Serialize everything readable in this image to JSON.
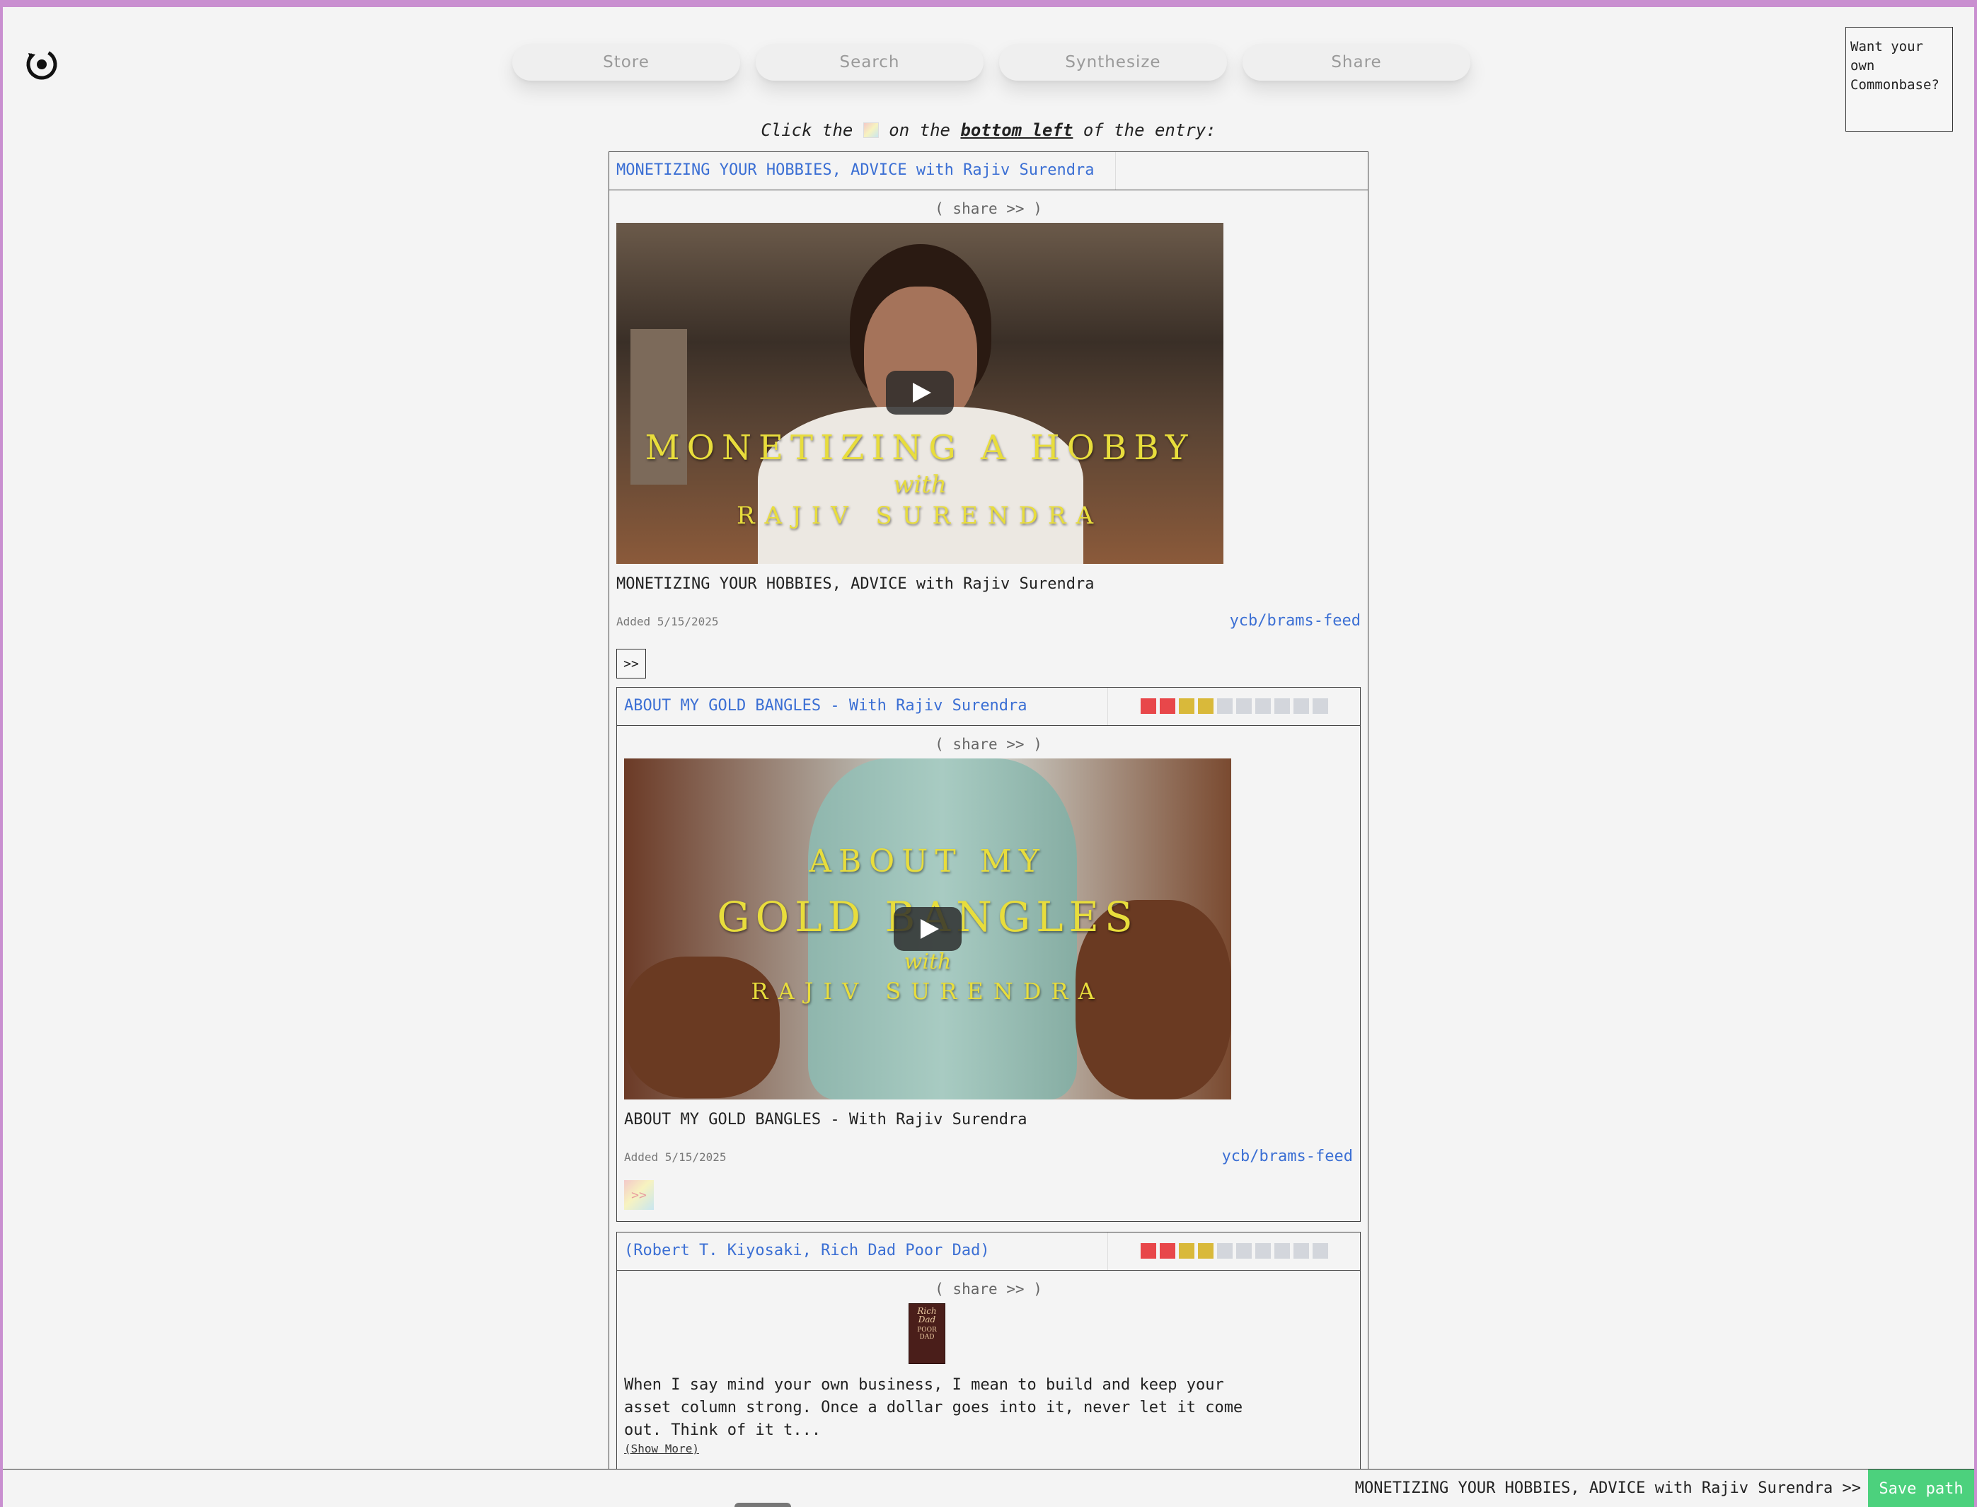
{
  "nav": {
    "store": "Store",
    "search": "Search",
    "synthesize": "Synthesize",
    "share": "Share"
  },
  "promo": {
    "text": "Want your own Commonbase?"
  },
  "instruction": {
    "pre": "Click the",
    "mid": "on the",
    "emph": "bottom left",
    "post": "of the entry:"
  },
  "entries": [
    {
      "title": "MONETIZING YOUR HOBBIES, ADVICE with Rajiv Surendra",
      "share": "( share >> )",
      "body": "MONETIZING YOUR HOBBIES, ADVICE with Rajiv Surendra",
      "added": "Added 5/15/2025",
      "feed": "ycb/brams-feed",
      "arrow": ">>",
      "video": {
        "line1": "MONETIZING A HOBBY",
        "line2": "with",
        "line3": "RAJIV SURENDRA"
      }
    },
    {
      "title": "ABOUT MY GOLD BANGLES - With Rajiv Surendra",
      "share": "( share >> )",
      "body": "ABOUT MY GOLD BANGLES - With Rajiv Surendra",
      "added": "Added 5/15/2025",
      "feed": "ycb/brams-feed",
      "arrow": ">>",
      "video": {
        "line1": "ABOUT MY",
        "line2": "GOLD BANGLES",
        "line3": "with",
        "line4": "RAJIV SURENDRA"
      }
    },
    {
      "title": "(Robert T. Kiyosaki, Rich Dad Poor Dad)",
      "share": "( share >> )",
      "book": {
        "l1": "Rich",
        "l2": "Dad",
        "l3": "POOR",
        "l4": "DAD"
      },
      "body_l1": "When I say mind your own business, I mean to build and keep your",
      "body_l2": "asset column strong. Once a dollar goes into it, never let it come",
      "body_l3": "out. Think of it t...",
      "show_more": "(Show More)"
    }
  ],
  "colors": {
    "red": "#e8474a",
    "yellow": "#d9b93a",
    "gray": "#d3d6dc",
    "link": "#3b6fd4",
    "save": "#4cd17d"
  },
  "bottom": {
    "path": "MONETIZING YOUR HOBBIES, ADVICE with Rajiv Surendra >>",
    "save": "Save path"
  }
}
